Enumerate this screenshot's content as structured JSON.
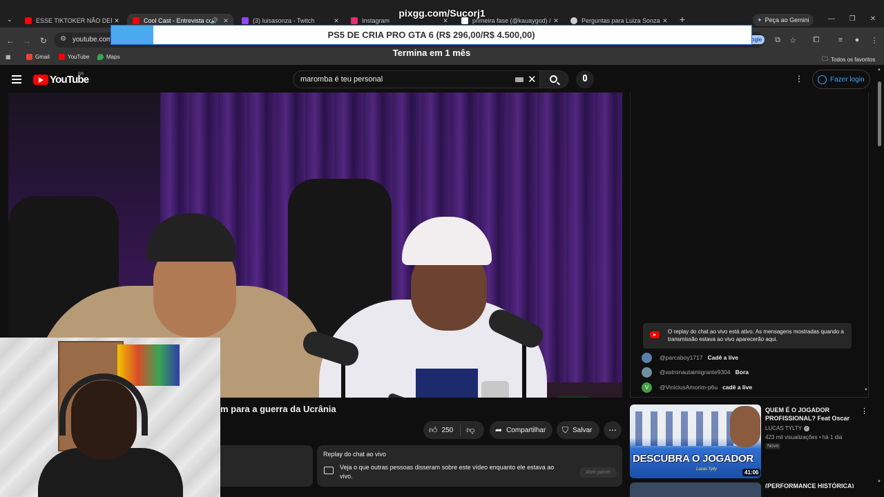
{
  "overlay": {
    "top_text": "pixgg.com/Sucorj1",
    "bar_text": "PS5 DE CRIA PRO GTA 6 (R$ 296,00/R$ 4.500,00)",
    "bar_progress": 0.066,
    "sub_text": "Termina em 1 mês"
  },
  "browser": {
    "tabs": [
      {
        "title": "ESSE TIKTOKER NÃO DEIXA O C",
        "favicon": "youtube-icon",
        "color": "#ff0000"
      },
      {
        "title": "Cool Cast - Entrevista com",
        "favicon": "youtube-icon",
        "color": "#ff0000",
        "active": true
      },
      {
        "title": "(3) luisasonza - Twitch",
        "favicon": "twitch-icon",
        "color": "#9146ff"
      },
      {
        "title": "Instagram",
        "favicon": "instagram-icon",
        "color": "#e1306c"
      },
      {
        "title": "primeira fase (@kauaygod) / X",
        "favicon": "x-icon",
        "color": "#ffffff"
      },
      {
        "title": "Perguntas para Luiza Sonza",
        "favicon": "chatgpt-icon",
        "color": "#cfcfcf"
      }
    ],
    "gemini_label": "Peça ao Gemini",
    "url": "youtube.com",
    "google_pill": "ogle",
    "bookmarks": [
      {
        "label": "Gmail",
        "color": "#ea4335"
      },
      {
        "label": "YouTube",
        "color": "#ff0000"
      },
      {
        "label": "Maps",
        "color": "#34a853"
      }
    ],
    "all_bookmarks": "Todos os favoritos"
  },
  "youtube": {
    "logo_text": "YouTube",
    "region": "BR",
    "search_value": "maromba é teu personal",
    "login_label": "Fazer login",
    "video_title": "m para a guerra da Ucrânia",
    "like_count": "250",
    "share_label": "Compartilhar",
    "save_label": "Salvar",
    "chat_replay": {
      "title": "Replay do chat ao vivo",
      "text": "Veja o que outras pessoas disseram sobre este vídeo enquanto ele estava ao vivo.",
      "button": "Abrir painel"
    },
    "live_chat": {
      "notice": "O replay do chat ao vivo está ativo. As mensagens mostradas quando a transmissão estava ao vivo aparecerão aqui.",
      "messages": [
        {
          "user": "@parcaboy1717",
          "text": "Cadê a live",
          "avatar_color": "#5a7fa8"
        },
        {
          "user": "@astronautaimigrante9304",
          "text": "Bora",
          "avatar_color": "#6e8fa0"
        },
        {
          "user": "@ViniciusAmorim-p6u",
          "text": "cadê a live",
          "avatar_color": "#43a047",
          "initial": "V"
        }
      ]
    },
    "recommendation": {
      "banner": "DESCUBRA O JOGADOR",
      "signature": "Lucas Tylty",
      "duration": "41:06",
      "title": "QUEM É O JOGADOR PROFISSIONAL? Feat Oscar",
      "channel": "LUCAS TYLTY",
      "meta": "423 mil visualizações • há 1 dia",
      "badge": "Novo",
      "next_title": "(PERFORMANCE HISTÓRICA)"
    }
  }
}
